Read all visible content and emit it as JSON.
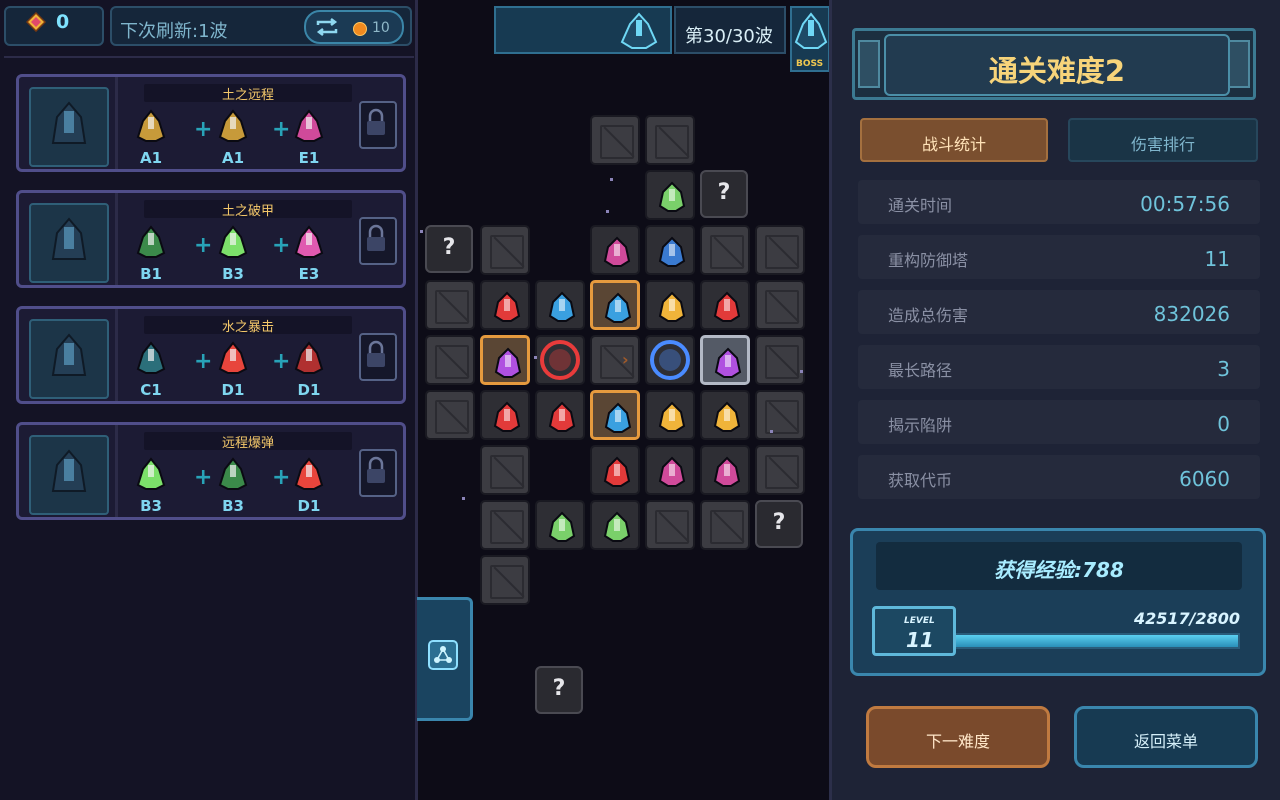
{
  "top_bar": {
    "gems": "0",
    "refresh_label": "下次刷新:1波",
    "reroll_cost": "10",
    "wave_label": "第30/30波",
    "boss_label": "BOSS"
  },
  "recipes": [
    {
      "title": "土之远程",
      "ingredients": [
        {
          "code": "A1",
          "color": "#c79a3a"
        },
        {
          "code": "A1",
          "color": "#c79a3a"
        },
        {
          "code": "E1",
          "color": "#d04a9a"
        }
      ]
    },
    {
      "title": "土之破甲",
      "ingredients": [
        {
          "code": "B1",
          "color": "#3b8a4a"
        },
        {
          "code": "B3",
          "color": "#7ce06a"
        },
        {
          "code": "E3",
          "color": "#e05ab0"
        }
      ]
    },
    {
      "title": "水之暴击",
      "ingredients": [
        {
          "code": "C1",
          "color": "#2b6f7a"
        },
        {
          "code": "D1",
          "color": "#e8453c"
        },
        {
          "code": "D1",
          "color": "#b03030"
        }
      ]
    },
    {
      "title": "远程爆弹",
      "ingredients": [
        {
          "code": "B3",
          "color": "#7ce06a"
        },
        {
          "code": "B3",
          "color": "#3b8a4a"
        },
        {
          "code": "D1",
          "color": "#e8453c"
        }
      ]
    }
  ],
  "result": {
    "difficulty_title": "通关难度2",
    "tabs": [
      "战斗统计",
      "伤害排行"
    ],
    "stats": [
      {
        "label": "通关时间",
        "value": "00:57:56"
      },
      {
        "label": "重构防御塔",
        "value": "11"
      },
      {
        "label": "造成总伤害",
        "value": "832026"
      },
      {
        "label": "最长路径",
        "value": "3"
      },
      {
        "label": "揭示陷阱",
        "value": "0"
      },
      {
        "label": "获取代币",
        "value": "6060"
      }
    ],
    "exp_label": "获得经验:788",
    "xp_text": "42517/2800",
    "xp_fill_fraction": 1.0,
    "level_caption": "LEVEL",
    "level": "11",
    "next_button": "下一难度",
    "menu_button": "返回菜单"
  },
  "icons": {
    "gem": "gem-icon",
    "reroll": "reroll-arrows-icon",
    "coin": "coin-icon",
    "lock": "lock-icon",
    "side_tab": "tower-nodes-icon"
  }
}
